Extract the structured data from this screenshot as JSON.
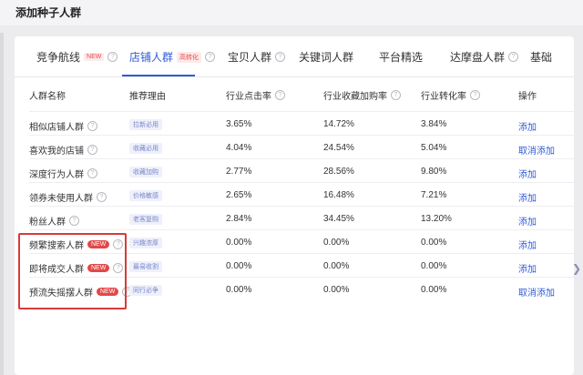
{
  "window": {
    "title": "添加种子人群"
  },
  "tabs": [
    {
      "label": "竞争航线",
      "badge": "NEW"
    },
    {
      "label": "店铺人群",
      "badge": "高转化"
    },
    {
      "label": "宝贝人群",
      "badge": ""
    },
    {
      "label": "关键词人群",
      "badge": ""
    },
    {
      "label": "平台精选",
      "badge": ""
    },
    {
      "label": "达摩盘人群",
      "badge": ""
    },
    {
      "label": "基础",
      "badge": ""
    }
  ],
  "table": {
    "headers": [
      "人群名称",
      "推荐理由",
      "行业点击率",
      "行业收藏加购率",
      "行业转化率",
      "操作"
    ],
    "rows": [
      {
        "name": "相似店铺人群",
        "new": "",
        "reason": "拉新必用",
        "ctr": "3.65%",
        "fav": "14.72%",
        "cvr": "3.84%",
        "action": "添加"
      },
      {
        "name": "喜欢我的店铺",
        "new": "",
        "reason": "收藏必用",
        "ctr": "4.04%",
        "fav": "24.54%",
        "cvr": "5.04%",
        "action": "取消添加"
      },
      {
        "name": "深度行为人群",
        "new": "",
        "reason": "收藏加购",
        "ctr": "2.77%",
        "fav": "28.56%",
        "cvr": "9.80%",
        "action": "添加"
      },
      {
        "name": "领券未使用人群",
        "new": "",
        "reason": "价格敏感",
        "ctr": "2.65%",
        "fav": "16.48%",
        "cvr": "7.21%",
        "action": "添加"
      },
      {
        "name": "粉丝人群",
        "new": "",
        "reason": "老客复购",
        "ctr": "2.84%",
        "fav": "34.45%",
        "cvr": "13.20%",
        "action": "添加"
      },
      {
        "name": "频繁搜索人群",
        "new": "NEW",
        "reason": "兴趣浓厚",
        "ctr": "0.00%",
        "fav": "0.00%",
        "cvr": "0.00%",
        "action": "添加"
      },
      {
        "name": "即将成交人群",
        "new": "NEW",
        "reason": "最易收割",
        "ctr": "0.00%",
        "fav": "0.00%",
        "cvr": "0.00%",
        "action": "添加"
      },
      {
        "name": "预流失摇摆人群",
        "new": "NEW",
        "reason": "同行必争",
        "ctr": "0.00%",
        "fav": "0.00%",
        "cvr": "0.00%",
        "action": "取消添加"
      }
    ]
  },
  "icons": {
    "help": "question-circle-icon",
    "scroll": "chevron-right-icon"
  },
  "colors": {
    "accent": "#2f5bd8",
    "new_badge": "#e34848",
    "highlight": "#d63b3b"
  }
}
